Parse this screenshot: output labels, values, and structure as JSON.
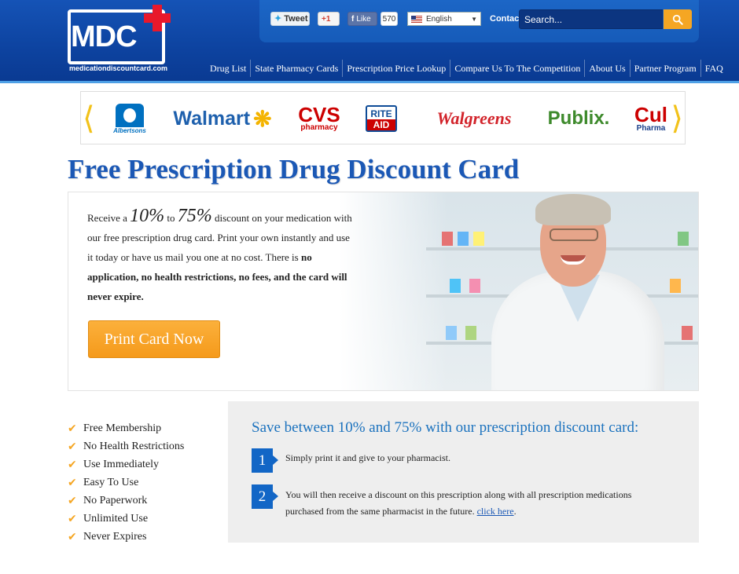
{
  "logo": {
    "mark": "MDC",
    "url": "medicationdiscountcard.com"
  },
  "topbar": {
    "tweet_label": "Tweet",
    "gplus_label": "+1",
    "fb_label": "Like",
    "fb_count": "570",
    "language": "English",
    "contact_label": "Contact",
    "search_placeholder": "Search..."
  },
  "nav": {
    "items": [
      {
        "label": "Drug List"
      },
      {
        "label": "State Pharmacy Cards"
      },
      {
        "label": "Prescription Price Lookup"
      },
      {
        "label": "Compare Us To The Competition"
      },
      {
        "label": "About Us"
      },
      {
        "label": "Partner Program"
      },
      {
        "label": "FAQ"
      }
    ]
  },
  "pharmacies": {
    "albertsons": "Albertsons",
    "walmart": "Walmart",
    "cvs_top": "CVS",
    "cvs_bottom": "pharmacy",
    "rite_top": "RITE",
    "rite_bottom": "AID",
    "walgreens": "Walgreens",
    "publix": "Publix.",
    "cub_top": "Cul",
    "cub_bottom": "Pharma"
  },
  "page": {
    "title": "Free Prescription Drug Discount Card"
  },
  "hero": {
    "intro_a": "Receive a ",
    "pct_low": "10%",
    "intro_to": " to ",
    "pct_high": "75%",
    "intro_b": " discount on your medication with our free prescription drug card. Print your own instantly and use it today or have us mail you one at no cost. There is ",
    "bold_text": "no application, no health restrictions, no fees, and the card will never expire.",
    "cta_label": "Print Card Now"
  },
  "features": [
    "Free Membership",
    "No Health Restrictions",
    "Use Immediately",
    "Easy To Use",
    "No Paperwork",
    "Unlimited Use",
    "Never Expires"
  ],
  "steps": {
    "title": "Save between 10% and 75% with our prescription discount card:",
    "items": [
      {
        "num": "1",
        "text": "Simply print it and give to your pharmacist."
      },
      {
        "num": "2",
        "text": "You will then receive a discount on this prescription along with all prescription medications purchased from the same pharmacist in the future. ",
        "link": "click here",
        "tail": "."
      }
    ]
  },
  "colors": {
    "brand_blue": "#1553b6",
    "accent_orange": "#f5a623",
    "title_blue": "#1b58b5",
    "red_cross": "#e8182b"
  }
}
